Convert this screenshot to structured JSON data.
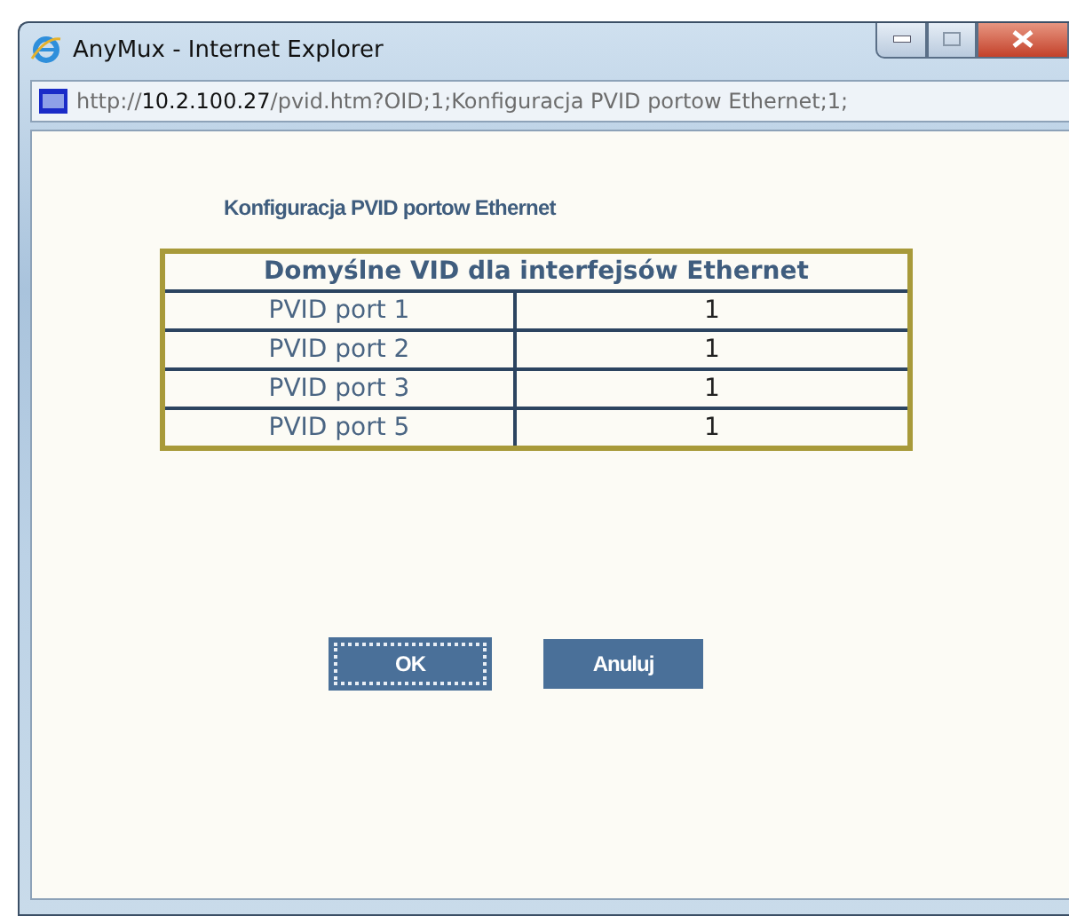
{
  "window": {
    "title": "AnyMux - Internet Explorer"
  },
  "address_bar": {
    "scheme": "http://",
    "host": "10.2.100.27",
    "path": "/pvid.htm?OID;1;Konfiguracja PVID portow Ethernet;1;"
  },
  "page": {
    "heading": "Konfiguracja PVID portow Ethernet",
    "table": {
      "caption": "Domyślne VID dla interfejsów Ethernet",
      "rows": [
        {
          "label": "PVID port 1",
          "value": "1"
        },
        {
          "label": "PVID port 2",
          "value": "1"
        },
        {
          "label": "PVID port 3",
          "value": "1"
        },
        {
          "label": "PVID port 5",
          "value": "1"
        }
      ]
    },
    "buttons": [
      {
        "label": "OK",
        "focused": true
      },
      {
        "label": "Anuluj",
        "focused": false
      }
    ]
  }
}
